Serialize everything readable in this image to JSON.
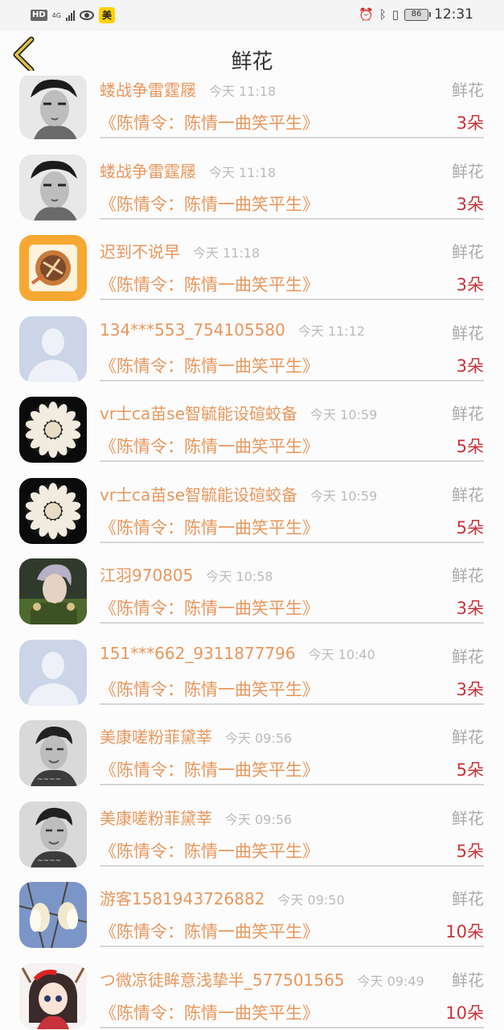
{
  "status_bar": {
    "left_badges": [
      "HD",
      "4G",
      "美"
    ],
    "icons": [
      "signal-icon",
      "eye-icon",
      "alarm-icon",
      "bluetooth-icon",
      "vibrate-icon"
    ],
    "battery": "86",
    "time": "12:31"
  },
  "nav": {
    "back_icon": "chevron-left-icon",
    "title": "鲜花"
  },
  "colors": {
    "username": "#e8975d",
    "room": "#e8975d",
    "count": "#c8323b",
    "muted": "#aaaaaa",
    "back_accent": "#e2c13c"
  },
  "records": [
    {
      "name": "蝼战争雷霆屦",
      "time": "今天 11:18",
      "gift": "鲜花",
      "room": "《陈情令：陈情一曲笑平生》",
      "count": "3朵",
      "avatar": "bw-portrait"
    },
    {
      "name": "蝼战争雷霆屦",
      "time": "今天 11:18",
      "gift": "鲜花",
      "room": "《陈情令：陈情一曲笑平生》",
      "count": "3朵",
      "avatar": "bw-portrait"
    },
    {
      "name": "迟到不说早",
      "time": "今天 11:18",
      "gift": "鲜花",
      "room": "《陈情令：陈情一曲笑平生》",
      "count": "3朵",
      "avatar": "orange-food"
    },
    {
      "name": "134***553_754105580",
      "time": "今天 11:12",
      "gift": "鲜花",
      "room": "《陈情令：陈情一曲笑平生》",
      "count": "3朵",
      "avatar": "default-user"
    },
    {
      "name": "vr士ca苗se智毓能设碹蛟备",
      "time": "今天 10:59",
      "gift": "鲜花",
      "room": "《陈情令：陈情一曲笑平生》",
      "count": "5朵",
      "avatar": "dumplings"
    },
    {
      "name": "vr士ca苗se智毓能设碹蛟备",
      "time": "今天 10:59",
      "gift": "鲜花",
      "room": "《陈情令：陈情一曲笑平生》",
      "count": "5朵",
      "avatar": "dumplings"
    },
    {
      "name": "江羽970805",
      "time": "今天 10:58",
      "gift": "鲜花",
      "room": "《陈情令：陈情一曲笑平生》",
      "count": "3朵",
      "avatar": "green-portrait"
    },
    {
      "name": "151***662_9311877796",
      "time": "今天 10:40",
      "gift": "鲜花",
      "room": "《陈情令：陈情一曲笑平生》",
      "count": "3朵",
      "avatar": "default-user"
    },
    {
      "name": "美康嗟粉菲黛莘",
      "time": "今天 09:56",
      "gift": "鲜花",
      "room": "《陈情令：陈情一曲笑平生》",
      "count": "5朵",
      "avatar": "bw-man"
    },
    {
      "name": "美康嗟粉菲黛莘",
      "time": "今天 09:56",
      "gift": "鲜花",
      "room": "《陈情令：陈情一曲笑平生》",
      "count": "5朵",
      "avatar": "bw-man"
    },
    {
      "name": "游客1581943726882",
      "time": "今天 09:50",
      "gift": "鲜花",
      "room": "《陈情令：陈情一曲笑平生》",
      "count": "10朵",
      "avatar": "magnolia"
    },
    {
      "name": "つ微凉徒眸意浅挚半_577501565",
      "time": "今天 09:49",
      "gift": "鲜花",
      "room": "《陈情令：陈情一曲笑平生》",
      "count": "10朵",
      "avatar": "anime-girl"
    }
  ]
}
